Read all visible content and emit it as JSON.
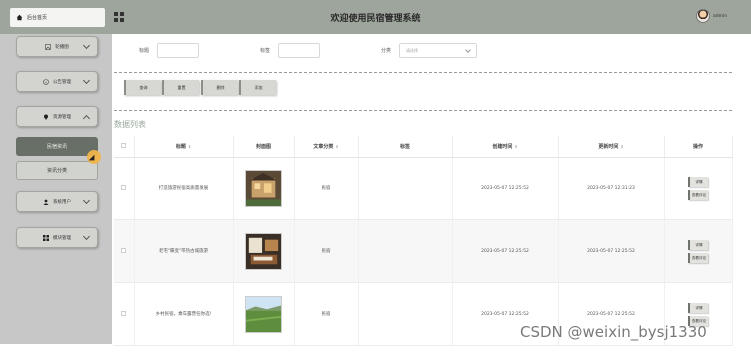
{
  "header": {
    "home_tab": "后台首页",
    "title": "欢迎使用民宿管理系统",
    "user": "admin"
  },
  "sidebar": {
    "items": [
      {
        "label": "轮播图",
        "icon": "image-icon"
      },
      {
        "label": "公告管理",
        "icon": "info-icon"
      },
      {
        "label": "资源管理",
        "icon": "location-pin-icon",
        "expanded": true
      },
      {
        "label": "系统用户",
        "icon": "user-icon"
      },
      {
        "label": "模块管理",
        "icon": "grid-icon"
      }
    ],
    "sub_items": [
      "民宿资讯",
      "资讯分类"
    ]
  },
  "search": {
    "title_label": "标题",
    "tags_label": "标签",
    "category_label": "分类",
    "category_placeholder": "请选择"
  },
  "toolbar": {
    "query": "查询",
    "reset": "重置",
    "delete": "删除",
    "add": "添加"
  },
  "section_title": "数据列表",
  "table": {
    "columns": [
      "标题",
      "封面图",
      "文章分类",
      "标签",
      "创建时间",
      "更新时间",
      "操作"
    ],
    "rows": [
      {
        "title": "打造旅游民宿高质量发展",
        "category": "民宿",
        "tags": "",
        "created": "2023-05-07 12:25:52",
        "updated": "2023-05-07 12:31:23"
      },
      {
        "title": "老宅\"蝶变\"带热古城旅游",
        "category": "民宿",
        "tags": "",
        "created": "2023-05-07 12:25:52",
        "updated": "2023-05-07 12:25:52"
      },
      {
        "title": "乡村民宿，乘车露营任你选!",
        "category": "民宿",
        "tags": "",
        "created": "2023-05-07 12:25:52",
        "updated": "2023-05-07 12:25:52"
      }
    ],
    "op_detail": "详情",
    "op_comment": "查看评论"
  },
  "watermark": "CSDN @weixin_bysj1330",
  "colors": {
    "header_bg": "#9ea59c",
    "sidebar_bg": "#c7c7c7",
    "active_sub": "#686f66"
  }
}
